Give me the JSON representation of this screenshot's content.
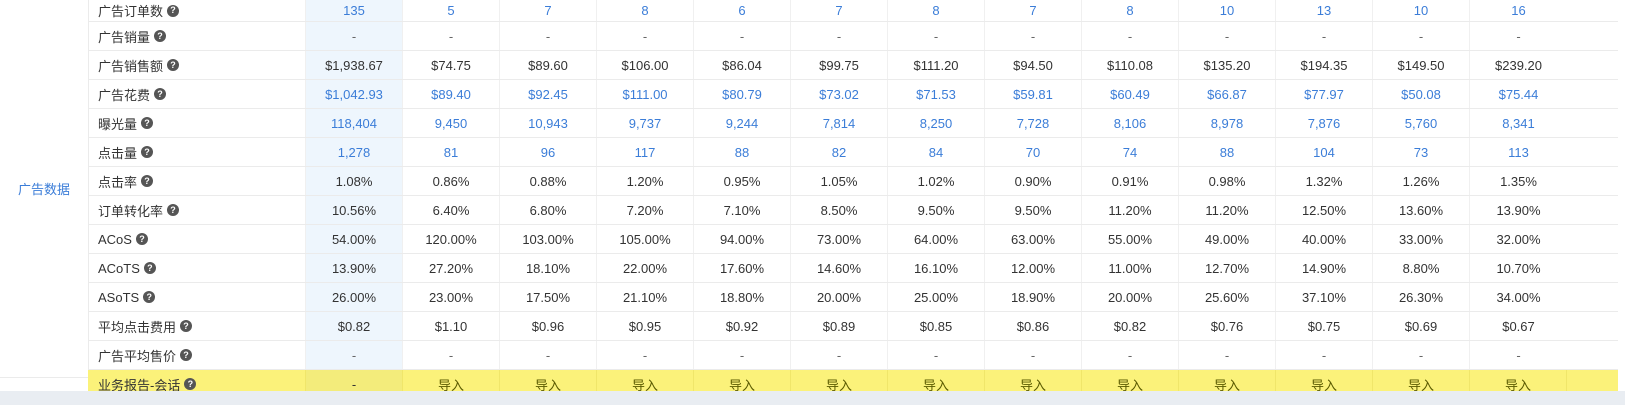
{
  "group_label": "广告数据",
  "rows": [
    {
      "label": "广告订单数",
      "values": [
        "135",
        "5",
        "7",
        "8",
        "6",
        "7",
        "8",
        "7",
        "8",
        "10",
        "13",
        "10",
        "16"
      ],
      "style": "blue"
    },
    {
      "label": "广告销量",
      "values": [
        "-",
        "-",
        "-",
        "-",
        "-",
        "-",
        "-",
        "-",
        "-",
        "-",
        "-",
        "-",
        "-"
      ],
      "style": "dash"
    },
    {
      "label": "广告销售额",
      "values": [
        "$1,938.67",
        "$74.75",
        "$89.60",
        "$106.00",
        "$86.04",
        "$99.75",
        "$111.20",
        "$94.50",
        "$110.08",
        "$135.20",
        "$194.35",
        "$149.50",
        "$239.20"
      ],
      "style": "normal"
    },
    {
      "label": "广告花费",
      "values": [
        "$1,042.93",
        "$89.40",
        "$92.45",
        "$111.00",
        "$80.79",
        "$73.02",
        "$71.53",
        "$59.81",
        "$60.49",
        "$66.87",
        "$77.97",
        "$50.08",
        "$75.44"
      ],
      "style": "blue"
    },
    {
      "label": "曝光量",
      "values": [
        "118,404",
        "9,450",
        "10,943",
        "9,737",
        "9,244",
        "7,814",
        "8,250",
        "7,728",
        "8,106",
        "8,978",
        "7,876",
        "5,760",
        "8,341"
      ],
      "style": "blue"
    },
    {
      "label": "点击量",
      "values": [
        "1,278",
        "81",
        "96",
        "117",
        "88",
        "82",
        "84",
        "70",
        "74",
        "88",
        "104",
        "73",
        "113"
      ],
      "style": "blue"
    },
    {
      "label": "点击率",
      "values": [
        "1.08%",
        "0.86%",
        "0.88%",
        "1.20%",
        "0.95%",
        "1.05%",
        "1.02%",
        "0.90%",
        "0.91%",
        "0.98%",
        "1.32%",
        "1.26%",
        "1.35%"
      ],
      "style": "normal"
    },
    {
      "label": "订单转化率",
      "values": [
        "10.56%",
        "6.40%",
        "6.80%",
        "7.20%",
        "7.10%",
        "8.50%",
        "9.50%",
        "9.50%",
        "11.20%",
        "11.20%",
        "12.50%",
        "13.60%",
        "13.90%"
      ],
      "style": "normal"
    },
    {
      "label": "ACoS",
      "values": [
        "54.00%",
        "120.00%",
        "103.00%",
        "105.00%",
        "94.00%",
        "73.00%",
        "64.00%",
        "63.00%",
        "55.00%",
        "49.00%",
        "40.00%",
        "33.00%",
        "32.00%"
      ],
      "style": "normal"
    },
    {
      "label": "ACoTS",
      "values": [
        "13.90%",
        "27.20%",
        "18.10%",
        "22.00%",
        "17.60%",
        "14.60%",
        "16.10%",
        "12.00%",
        "11.00%",
        "12.70%",
        "14.90%",
        "8.80%",
        "10.70%"
      ],
      "style": "normal"
    },
    {
      "label": "ASoTS",
      "values": [
        "26.00%",
        "23.00%",
        "17.50%",
        "21.10%",
        "18.80%",
        "20.00%",
        "25.00%",
        "18.90%",
        "20.00%",
        "25.60%",
        "37.10%",
        "26.30%",
        "34.00%"
      ],
      "style": "normal"
    },
    {
      "label": "平均点击费用",
      "values": [
        "$0.82",
        "$1.10",
        "$0.96",
        "$0.95",
        "$0.92",
        "$0.89",
        "$0.85",
        "$0.86",
        "$0.82",
        "$0.76",
        "$0.75",
        "$0.69",
        "$0.67"
      ],
      "style": "normal"
    },
    {
      "label": "广告平均售价",
      "values": [
        "-",
        "-",
        "-",
        "-",
        "-",
        "-",
        "-",
        "-",
        "-",
        "-",
        "-",
        "-",
        "-"
      ],
      "style": "dash"
    },
    {
      "label": "业务报告-会话",
      "values": [
        "-",
        "导入",
        "导入",
        "导入",
        "导入",
        "导入",
        "导入",
        "导入",
        "导入",
        "导入",
        "导入",
        "导入",
        "导入"
      ],
      "style": "highlight"
    }
  ],
  "help_icon_glyph": "?",
  "colors": {
    "link_blue": "#3b7dd8",
    "highlight_yellow": "#fbf27a",
    "total_column_bg": "#eef6fd"
  }
}
